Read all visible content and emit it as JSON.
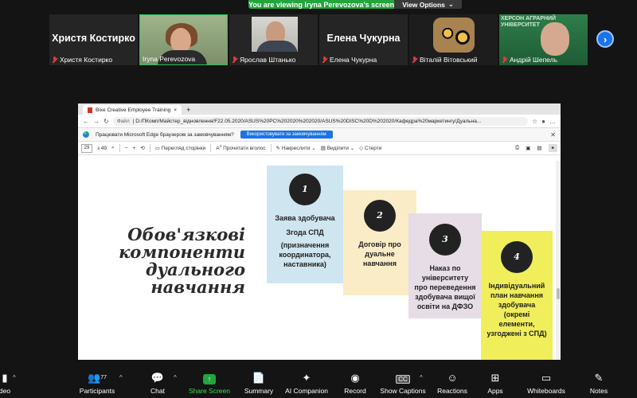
{
  "banner": {
    "text": "You are viewing Iryna Perevozova's screen",
    "view_options": "View Options"
  },
  "participants": [
    {
      "big": "Христя Костирко",
      "name": "Христя Костирко"
    },
    {
      "big": "",
      "name": "Iryna Perevozova"
    },
    {
      "big": "",
      "name": "Ярослав Штанько"
    },
    {
      "big": "Елена Чукурна",
      "name": "Елена Чукурна"
    },
    {
      "big": "",
      "name": "Віталій Вітовський"
    },
    {
      "big": "",
      "name": "Андрій Шепель"
    }
  ],
  "andriy_bg_text": "ХЕРСОН АГРАРНИЙ УНІВЕРСИТЕТ",
  "browser": {
    "tab_title": "Bixe Creative Employee Training",
    "address_prefix": "Файл",
    "url": "D:/ПКомп/Майстер_відновлення/F22.05.2020/ASUS%20PC%202020%202020/ASUS%20DISC%20D%202020/Кафедра%20маркетингу/Дуальна...",
    "edge_prompt": "Працювати Microsoft Edge браузером за замовчуванням?",
    "edge_button": "Використовувати за замовчуванням",
    "page_num": "29",
    "page_total": "з 49",
    "tools": [
      "Перегляд сторінки",
      "Прочитати вголос",
      "Накреслити",
      "Виділити",
      "Стерти"
    ]
  },
  "slide": {
    "title_lines": [
      "Обов'язкові",
      "компоненти",
      "дуального",
      "навчання"
    ],
    "cards": [
      {
        "num": "1",
        "lines": [
          "Заява здобувача",
          "Згода СПД",
          "(призначення",
          "координатора,",
          "наставника)"
        ]
      },
      {
        "num": "2",
        "lines": [
          "Договір про",
          "дуальне",
          "навчання"
        ]
      },
      {
        "num": "3",
        "lines": [
          "Наказ по",
          "університету",
          "про переведення",
          "здобувача вищої",
          "освіти на ДФЗО"
        ]
      },
      {
        "num": "4",
        "lines": [
          "Індивідуальний",
          "план навчання",
          "здобувача",
          "(окремі",
          "елементи,",
          "узгоджені з СПД)"
        ]
      }
    ]
  },
  "toolbar": {
    "video": "deo",
    "participants": "Participants",
    "participants_count": "77",
    "chat": "Chat",
    "share": "Share Screen",
    "summary": "Summary",
    "ai": "AI Companion",
    "record": "Record",
    "captions": "Show Captions",
    "reactions": "Reactions",
    "apps": "Apps",
    "whiteboards": "Whiteboards",
    "notes": "Notes"
  }
}
